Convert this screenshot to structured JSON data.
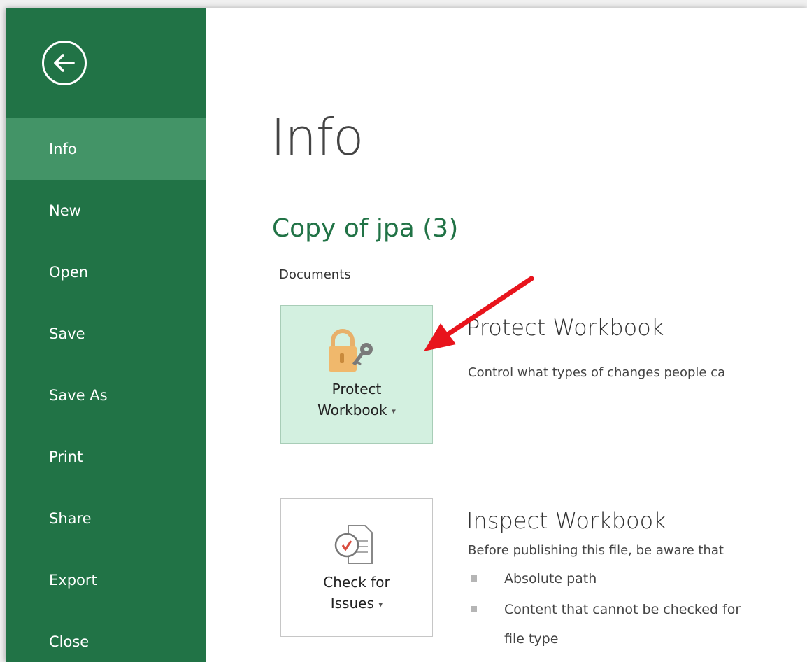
{
  "sidebar": {
    "back_icon": "back-arrow-icon",
    "items": [
      {
        "label": "Info",
        "active": true
      },
      {
        "label": "New"
      },
      {
        "label": "Open"
      },
      {
        "label": "Save"
      },
      {
        "label": "Save As"
      },
      {
        "label": "Print"
      },
      {
        "label": "Share"
      },
      {
        "label": "Export"
      },
      {
        "label": "Close"
      }
    ]
  },
  "main": {
    "title": "Info",
    "document_name": "Copy of jpa (3)",
    "document_location": "Documents",
    "protect": {
      "button_line1": "Protect",
      "button_line2": "Workbook",
      "heading": "Protect Workbook",
      "description": "Control what types of changes people ca"
    },
    "inspect": {
      "button_line1": "Check for",
      "button_line2": "Issues",
      "heading": "Inspect Workbook",
      "description": "Before publishing this file, be aware that",
      "bullets": [
        "Absolute path",
        "Content that cannot be checked for",
        "file type"
      ]
    }
  },
  "colors": {
    "brand_green": "#217346",
    "sidebar_active": "#439467",
    "selected_tile": "#d3f0e0",
    "annotation_arrow": "#e8141c"
  }
}
